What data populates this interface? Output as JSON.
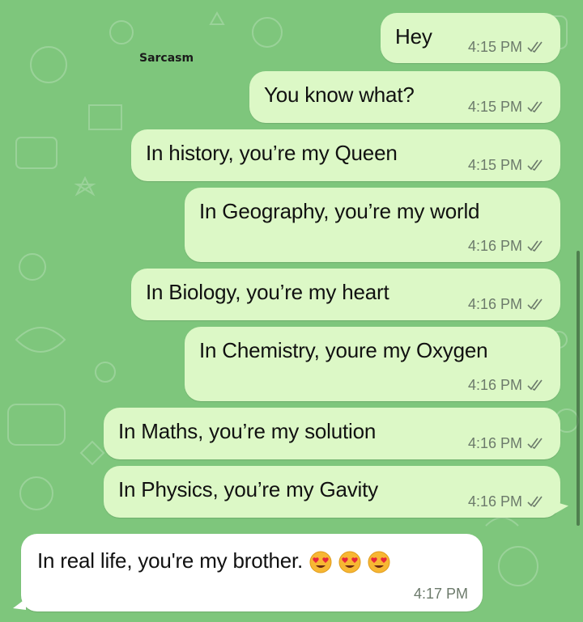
{
  "watermark": "Sarcasm",
  "colors": {
    "background": "#7ec67c",
    "outgoing_bubble": "#dcf8c6",
    "incoming_bubble": "#ffffff",
    "timestamp": "#6c7a6b"
  },
  "messages": [
    {
      "text": "Hey",
      "time": "4:15 PM",
      "direction": "outgoing",
      "status": "double-check"
    },
    {
      "text": "You know what?",
      "time": "4:15 PM",
      "direction": "outgoing",
      "status": "double-check"
    },
    {
      "text": "In history, you’re my Queen",
      "time": "4:15 PM",
      "direction": "outgoing",
      "status": "double-check"
    },
    {
      "text": "In Geography, you’re my world",
      "time": "4:16 PM",
      "direction": "outgoing",
      "status": "double-check"
    },
    {
      "text": "In Biology, you’re my heart",
      "time": "4:16 PM",
      "direction": "outgoing",
      "status": "double-check"
    },
    {
      "text": "In Chemistry, youre my Oxygen",
      "time": "4:16 PM",
      "direction": "outgoing",
      "status": "double-check"
    },
    {
      "text": "In Maths, you’re my solution",
      "time": "4:16 PM",
      "direction": "outgoing",
      "status": "double-check"
    },
    {
      "text": "In Physics, you’re my Gavity",
      "time": "4:16 PM",
      "direction": "outgoing",
      "status": "double-check"
    },
    {
      "text": "In real life, you're my brother.",
      "time": "4:17 PM",
      "direction": "incoming",
      "emojis": [
        "heart-eyes-emoji",
        "heart-eyes-emoji",
        "heart-eyes-emoji"
      ]
    }
  ]
}
